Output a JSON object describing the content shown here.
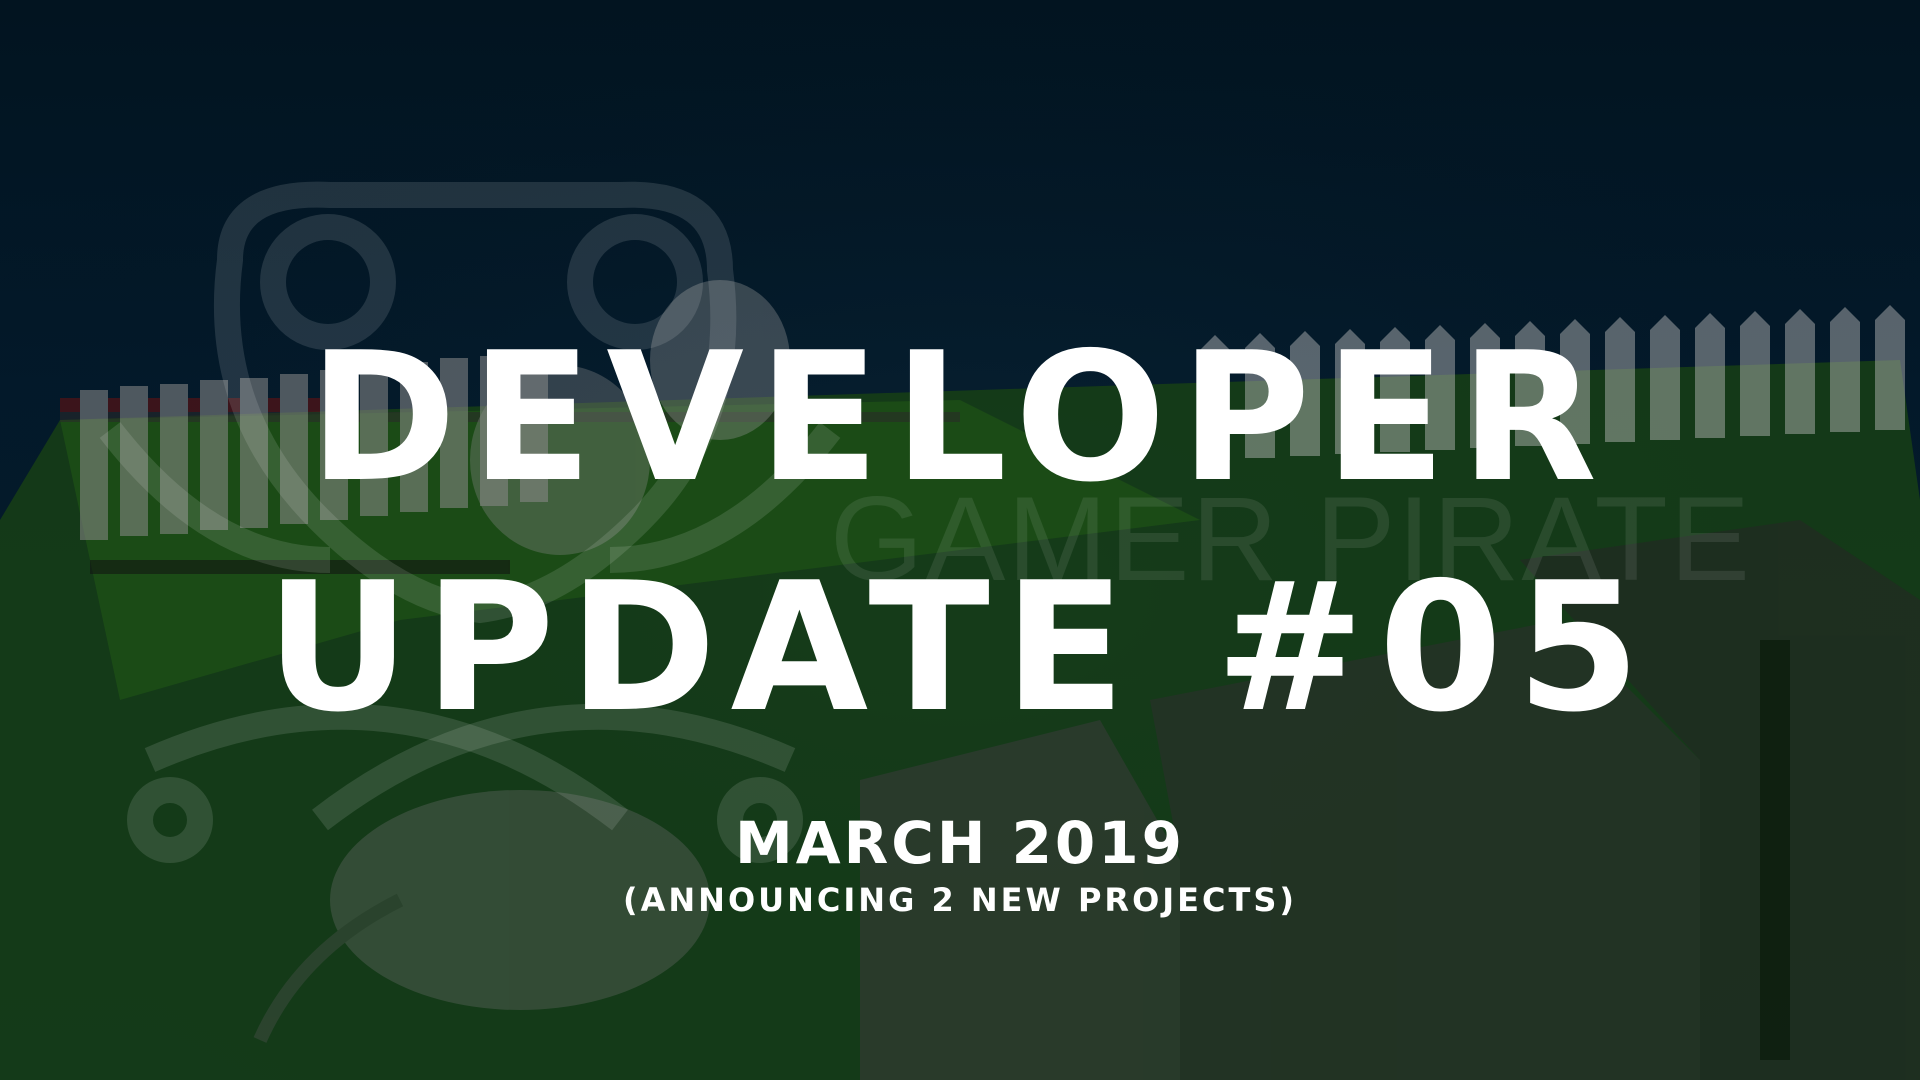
{
  "slide": {
    "title_line1": "DEVELOPER",
    "title_line2": "UPDATE #05",
    "date": "MARCH 2019",
    "subtitle": "(ANNOUNCING 2 NEW PROJECTS)"
  },
  "watermark": {
    "brand": "GAMER PIRATE",
    "logo_icon": "controller-skull-crossed-swords-icon"
  },
  "colors": {
    "background": "#021420",
    "grass": "#1e5a1a",
    "fence": "#c8c8c8",
    "text": "#ffffff"
  }
}
